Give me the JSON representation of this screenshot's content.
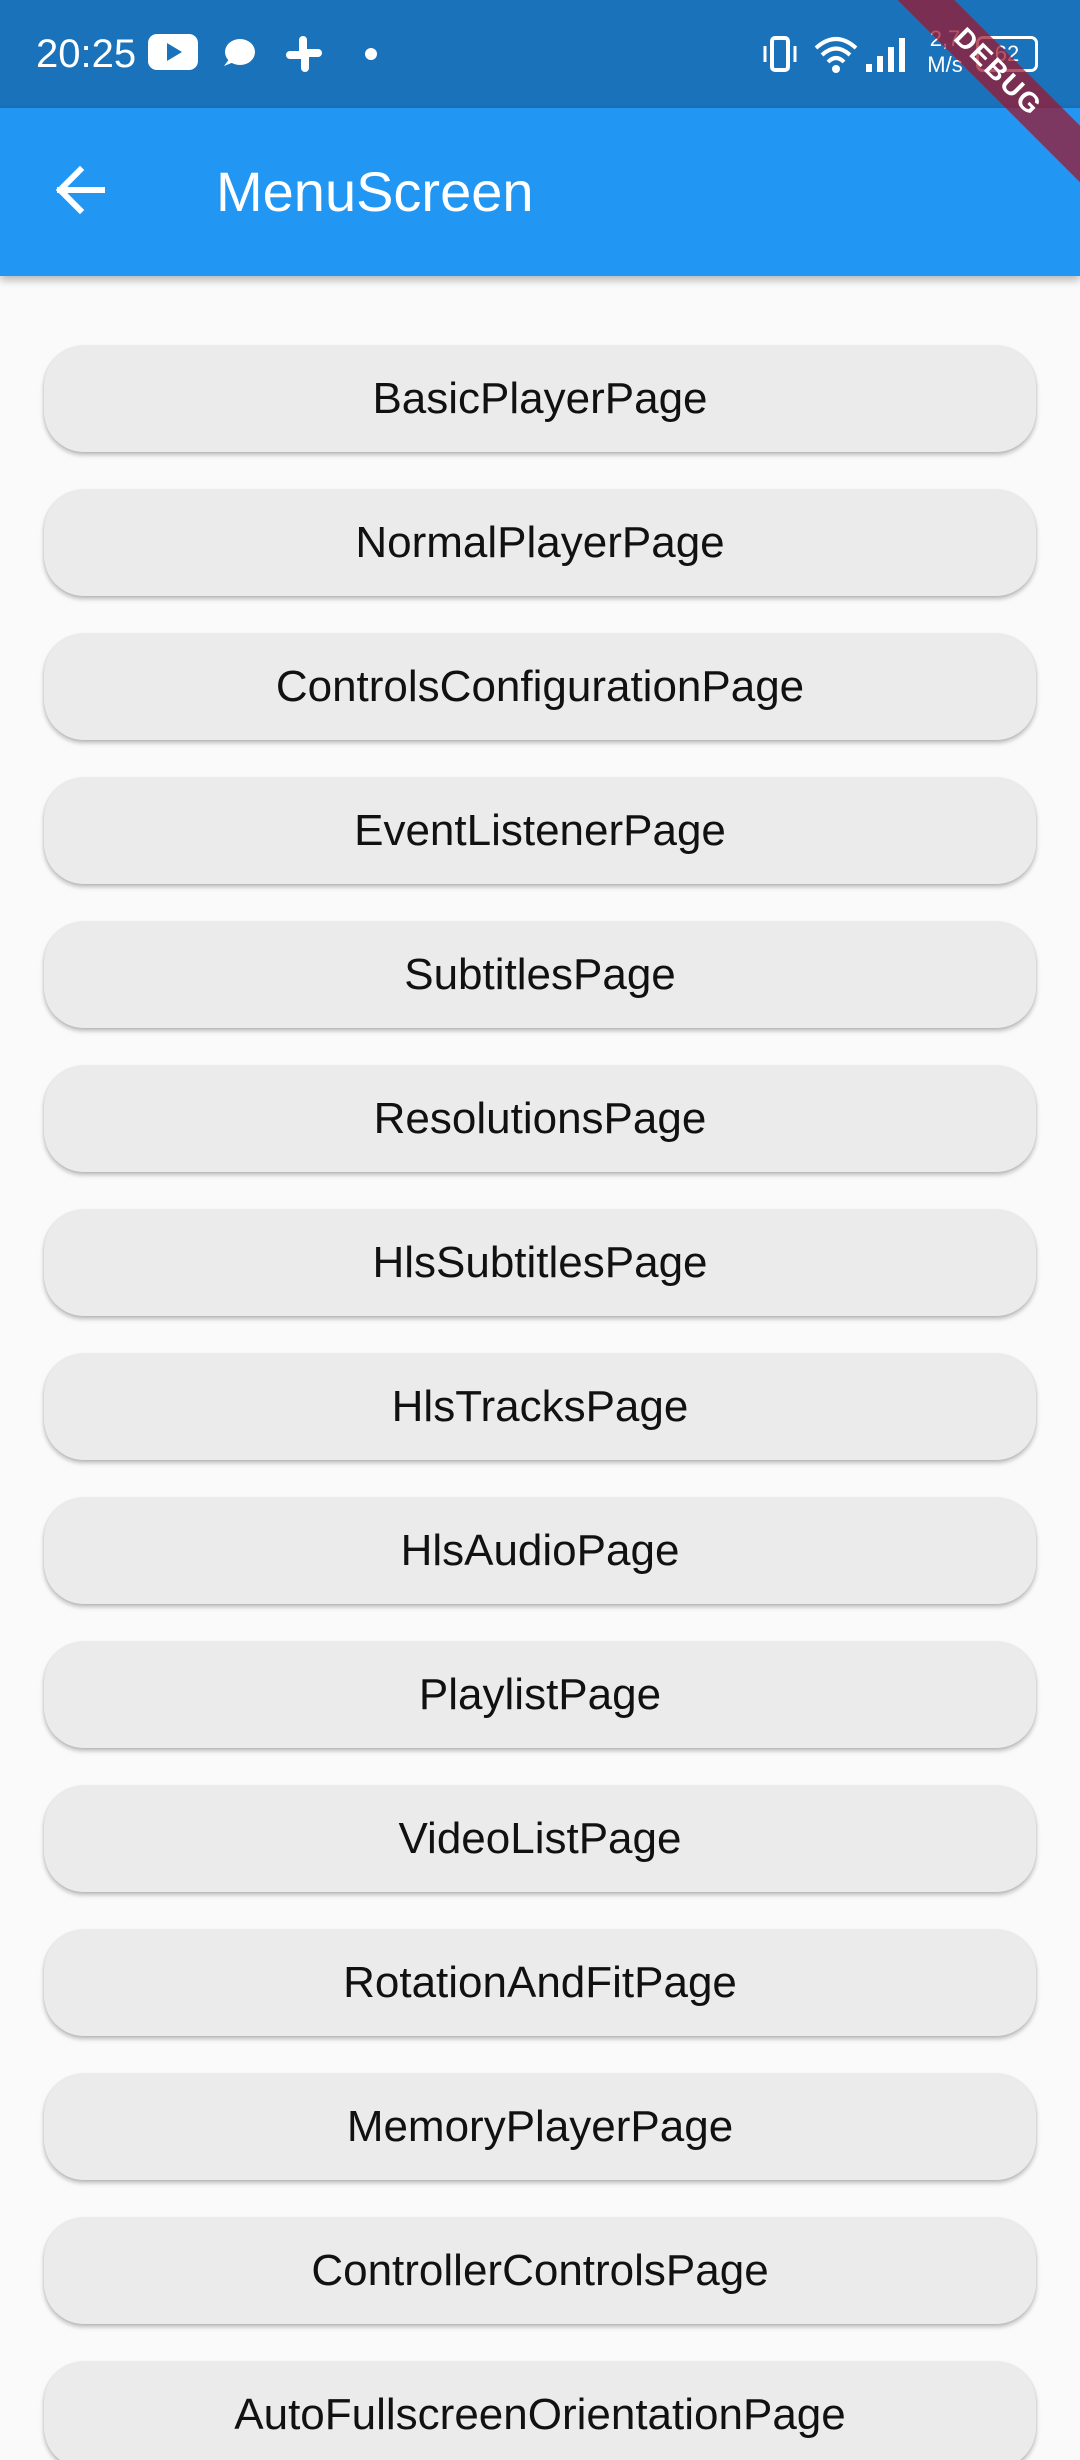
{
  "status_bar": {
    "time": "20:25",
    "notification_icons": [
      "youtube-icon",
      "chat-bubble-icon",
      "slack-icon",
      "dot-icon"
    ],
    "system_icons": [
      "vibrate-icon",
      "wifi-icon",
      "signal-icon",
      "battery-icon"
    ],
    "network_speed_value": "2,7",
    "network_speed_unit": "M/s",
    "battery_level": "62"
  },
  "app_bar": {
    "back_icon": "arrow-back-icon",
    "title": "MenuScreen",
    "background": "#2196f3"
  },
  "debug_banner": {
    "label": "DEBUG"
  },
  "menu": {
    "items": [
      "BasicPlayerPage",
      "NormalPlayerPage",
      "ControlsConfigurationPage",
      "EventListenerPage",
      "SubtitlesPage",
      "ResolutionsPage",
      "HlsSubtitlesPage",
      "HlsTracksPage",
      "HlsAudioPage",
      "PlaylistPage",
      "VideoListPage",
      "RotationAndFitPage",
      "MemoryPlayerPage",
      "ControllerControlsPage",
      "AutoFullscreenOrientationPage"
    ]
  },
  "colors": {
    "status_bar": "#1a72bb",
    "app_bar": "#2196f3",
    "page_background": "#fafafa",
    "button_background": "#ebebeb",
    "button_text": "#111111"
  }
}
